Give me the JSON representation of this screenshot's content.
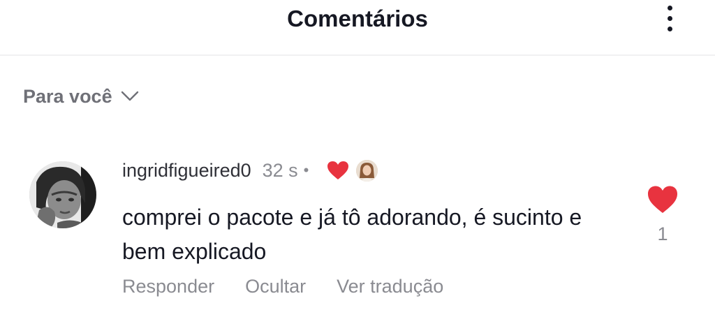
{
  "header": {
    "title": "Comentários",
    "more_icon": "more-vertical-icon"
  },
  "filter": {
    "label": "Para você",
    "chevron_icon": "chevron-down-icon"
  },
  "comment": {
    "username": "ingridfigueired0",
    "time": "32 s",
    "separator": "•",
    "creator_liked_icon": "heart-icon",
    "text": "comprei o pacote e já tô adorando, é sucinto e bem explicado",
    "actions": {
      "reply": "Responder",
      "hide": "Ocultar",
      "translate": "Ver tradução"
    },
    "like_count": "1"
  },
  "colors": {
    "heart": "#fe2c55",
    "heart_red": "#e8333f",
    "muted_text": "#8a8b91",
    "primary_text": "#161823"
  }
}
